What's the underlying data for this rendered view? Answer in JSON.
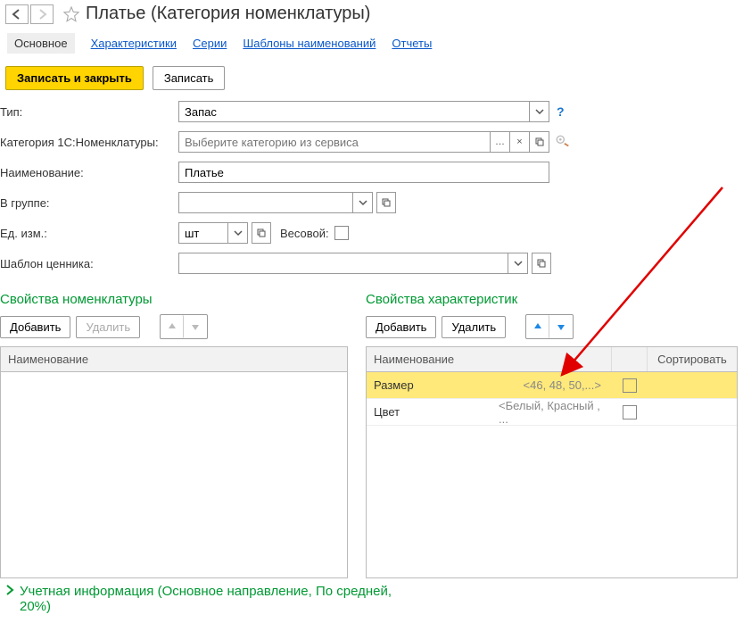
{
  "title": "Платье (Категория номенклатуры)",
  "tabs": {
    "main": "Основное",
    "characteristics": "Характеристики",
    "series": "Серии",
    "name_templates": "Шаблоны наименований",
    "reports": "Отчеты"
  },
  "actions": {
    "save_close": "Записать и закрыть",
    "save": "Записать"
  },
  "fields": {
    "type_label": "Тип:",
    "type_value": "Запас",
    "category_label": "Категория 1С:Номенклатуры:",
    "category_placeholder": "Выберите категорию из сервиса",
    "name_label": "Наименование:",
    "name_value": "Платье",
    "in_group_label": "В группе:",
    "unit_label": "Ед. изм.:",
    "unit_value": "шт",
    "weight_label": "Весовой:",
    "pricetag_tpl_label": "Шаблон ценника:"
  },
  "sections": {
    "nomenclature_props": {
      "title": "Свойства номенклатуры",
      "add": "Добавить",
      "delete": "Удалить",
      "column_name": "Наименование"
    },
    "characteristic_props": {
      "title": "Свойства характеристик",
      "add": "Добавить",
      "delete": "Удалить",
      "column_name": "Наименование",
      "column_sort": "Сортировать",
      "rows": [
        {
          "name": "Размер",
          "hint": "<46, 48, 50,...>"
        },
        {
          "name": "Цвет",
          "hint": "<Белый, Красный , ..."
        }
      ]
    }
  },
  "footer": {
    "accounting_info": "Учетная информация (Основное направление, По средней, 20%)"
  }
}
